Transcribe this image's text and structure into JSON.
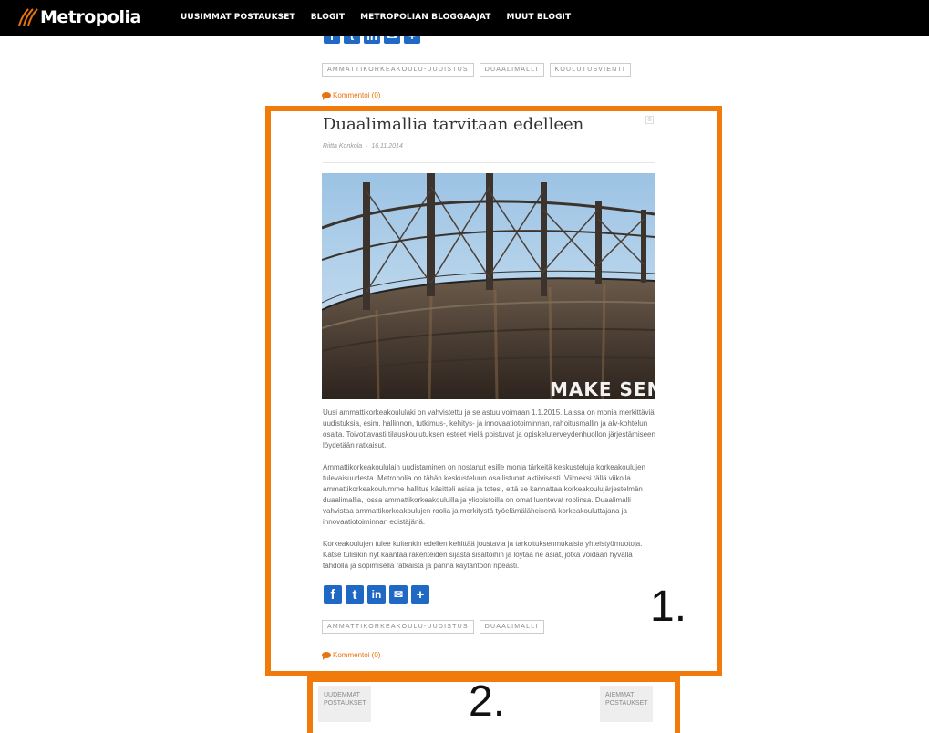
{
  "header": {
    "brand": "Metropolia",
    "nav": [
      "UUSIMMAT POSTAUKSET",
      "BLOGIT",
      "METROPOLIAN BLOGGAAJAT",
      "MUUT BLOGIT"
    ]
  },
  "previous_post": {
    "tags": [
      "AMMATTIKORKEAKOULU-UUDISTUS",
      "DUAALIMALLI",
      "KOULUTUSVIENTI"
    ],
    "comment_link": "Kommentoi (0)"
  },
  "article": {
    "title": "Duaalimallia tarvitaan edelleen",
    "author": "Riitta Konkola",
    "date": "16.11.2014",
    "image_caption_text": "MAKE SENSE",
    "paragraphs": [
      "Uusi ammattikorkeakoululaki on vahvistettu ja se astuu voimaan 1.1.2015. Laissa on monia merkittäviä uudistuksia, esim. hallinnon, tutkimus-, kehitys- ja innovaatiotoiminnan, rahoitusmallin ja alv-kohtelun osalta. Toivottavasti tilauskoulutuksen esteet vielä poistuvat ja opiskeluterveydenhuollon järjestämiseen löydetään ratkaisut.",
      "Ammattikorkeakoululain uudistaminen on nostanut esille monia tärkeitä keskusteluja korkeakoulujen tulevaisuudesta. Metropolia on tähän keskusteluun osallistunut aktiivisesti. Viimeksi tällä viikolla ammattikorkeakoulumme hallitus käsitteli asiaa ja totesi, että se kannattaa korkeakoulujärjestelmän duaalimallia, jossa ammattikorkeakouluilla ja yliopistoilla on omat luontevat roolinsa. Duaalimalli vahvistaa ammattikorkeakoulujen roolia ja merkitystä työelämäläheisenä korkeakouluttajana ja innovaatiotoiminnan edistäjänä.",
      "Korkeakoulujen tulee kuitenkin edellen kehittää joustavia ja tarkoituksenmukaisia yhteistyömuotoja. Katse tulisikin nyt kääntää rakenteiden sijasta sisältöihin ja löytää ne asiat, jotka voidaan hyvällä tahdolla ja sopimisella ratkaista ja panna käytäntöön ripeästi."
    ],
    "share_icons": [
      "facebook-icon",
      "twitter-icon",
      "linkedin-icon",
      "email-icon",
      "plus-icon"
    ],
    "tags": [
      "AMMATTIKORKEAKOULU-UUDISTUS",
      "DUAALIMALLI"
    ],
    "comment_link": "Kommentoi (0)"
  },
  "pager": {
    "newer": "UUDEMMAT POSTAUKSET",
    "older": "AIEMMAT POSTAUKSET"
  },
  "annotations": {
    "label1": "1.",
    "label2": "2.",
    "color": "#f07a0a"
  },
  "colors": {
    "accent": "#e8730c",
    "share": "#1f69c4",
    "header": "#000000"
  }
}
